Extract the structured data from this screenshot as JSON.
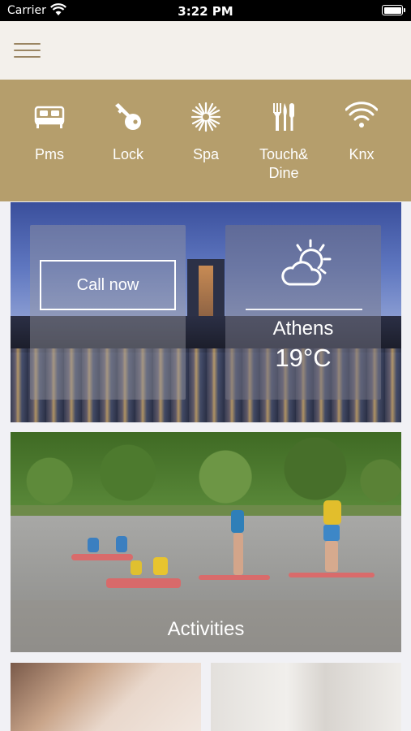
{
  "status_bar": {
    "carrier": "Carrier",
    "time": "3:22 PM"
  },
  "header": {
    "menu_icon": "hamburger-icon"
  },
  "services": [
    {
      "label": "Pms",
      "icon": "bed-icon"
    },
    {
      "label": "Lock",
      "icon": "key-icon"
    },
    {
      "label": "Spa",
      "icon": "spa-flower-icon"
    },
    {
      "label": "Touch&\nDine",
      "icon": "fork-knife-icon"
    },
    {
      "label": "Knx",
      "icon": "wifi-icon"
    }
  ],
  "hero": {
    "call_label": "Call now",
    "weather": {
      "icon": "partly-cloudy-icon",
      "city": "Athens",
      "temperature": "19°C"
    }
  },
  "activities": {
    "label": "Activities"
  },
  "colors": {
    "accent": "#b59e6c",
    "header_bg": "#f3f0eb",
    "menu_icon": "#9a8562"
  }
}
